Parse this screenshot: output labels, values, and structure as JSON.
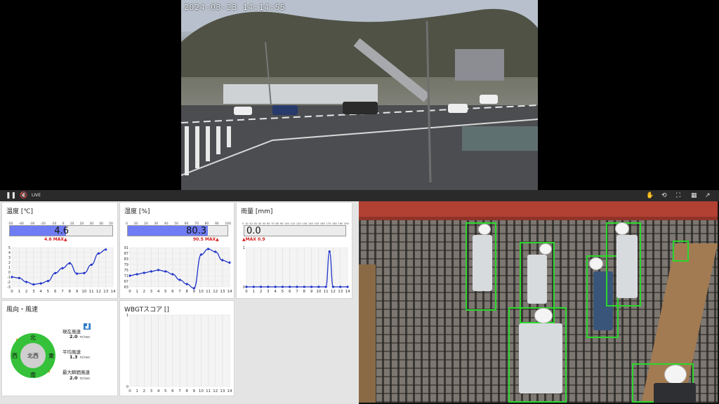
{
  "video": {
    "timestamp": "2024-03-23 14:14:55",
    "controls": {
      "pause_icon": "pause-icon",
      "mute_icon": "mute-icon",
      "live_label": "LIVE",
      "hand_icon": "hand-icon",
      "rotate_icon": "rotate-icon",
      "fullscreen_icon": "fullscreen-icon",
      "grid_icon": "grid-icon",
      "popout_icon": "external-link-icon"
    }
  },
  "dashboard": {
    "temperature": {
      "title": "温度 [℃]",
      "scale": [
        "-50",
        "-40",
        "-30",
        "-20",
        "-10",
        "0",
        "10",
        "20",
        "30",
        "40",
        "50"
      ],
      "value": "4.6",
      "fill_fraction": 0.546,
      "max_text": "4.6 MAX▲",
      "fill_color": "#6f7cf4"
    },
    "humidity": {
      "title": "湿度 [%]",
      "scale": [
        "0",
        "10",
        "20",
        "30",
        "40",
        "50",
        "60",
        "70",
        "80",
        "90",
        "100"
      ],
      "value": "80.3",
      "fill_fraction": 0.803,
      "max_text": "90.5 MAX▲",
      "fill_color": "#6f7cf4"
    },
    "rain": {
      "title": "雨量 [mm]",
      "scale": [
        "0",
        "10",
        "20",
        "30",
        "40",
        "50",
        "60",
        "70",
        "80",
        "90",
        "100",
        "110",
        "120",
        "130",
        "140",
        "150",
        "160",
        "170",
        "180",
        "190",
        "200"
      ],
      "value": "0.0",
      "fill_fraction": 0,
      "max_text": "▲MAX 0.9"
    },
    "wind": {
      "title": "風向・風速",
      "current_label": "現在風速",
      "current_value": "2.0",
      "avg_label": "平均風速",
      "avg_value": "1.3",
      "max_label": "最大瞬間風速",
      "max_value": "2.0",
      "unit": "m/sec",
      "compass": {
        "n": "北",
        "s": "南",
        "e": "東",
        "w": "西",
        "center": "北西"
      },
      "info_icon": "chart-icon"
    },
    "wbgt": {
      "title": "WBGTスコア []"
    }
  },
  "chart_data": [
    {
      "type": "line",
      "name": "temperature",
      "x": [
        0,
        1,
        2,
        3,
        4,
        5,
        6,
        7,
        8,
        9,
        10,
        11,
        12,
        13,
        14
      ],
      "values": [
        -1,
        -1.2,
        -2,
        -2.5,
        -2.3,
        -1.8,
        -0.2,
        0.8,
        1.8,
        -0.3,
        -0.2,
        1.5,
        3.8,
        4.6,
        null
      ],
      "xlim": [
        0,
        14
      ],
      "ylim": [
        -3,
        5
      ],
      "yticks": [
        "-3",
        "-2",
        "-1",
        "0",
        "1",
        "2",
        "3",
        "4",
        "5"
      ],
      "xticks": [
        "0",
        "1",
        "2",
        "3",
        "4",
        "5",
        "6",
        "7",
        "8",
        "9",
        "10",
        "11",
        "12",
        "13",
        "14"
      ]
    },
    {
      "type": "line",
      "name": "humidity",
      "x": [
        0,
        1,
        2,
        3,
        4,
        5,
        6,
        7,
        8,
        9,
        10,
        11,
        12,
        13,
        14
      ],
      "values": [
        71,
        72,
        73,
        74,
        75,
        74,
        72,
        68,
        65,
        62,
        86,
        90,
        88,
        82,
        80.3
      ],
      "xlim": [
        0,
        14
      ],
      "ylim": [
        63,
        91
      ],
      "yticks": [
        "63",
        "67",
        "71",
        "75",
        "79",
        "83",
        "87",
        "91"
      ],
      "xticks": [
        "0",
        "1",
        "2",
        "3",
        "4",
        "5",
        "6",
        "7",
        "8",
        "9",
        "10",
        "11",
        "12",
        "13",
        "14"
      ]
    },
    {
      "type": "line",
      "name": "rain",
      "x": [
        0,
        1,
        2,
        3,
        4,
        5,
        6,
        7,
        8,
        9,
        10,
        11,
        11.5,
        12,
        13,
        14
      ],
      "values": [
        0,
        0,
        0,
        0,
        0,
        0,
        0,
        0,
        0,
        0,
        0,
        0,
        0.9,
        0,
        0,
        0
      ],
      "xlim": [
        0,
        14
      ],
      "ylim": [
        0,
        1
      ],
      "yticks": [
        "0",
        "1"
      ],
      "xticks": [
        "0",
        "1",
        "2",
        "3",
        "4",
        "5",
        "6",
        "7",
        "8",
        "9",
        "10",
        "11",
        "12",
        "13",
        "14"
      ]
    },
    {
      "type": "line",
      "name": "wbgt",
      "x": [],
      "values": [],
      "xlim": [
        0,
        14
      ],
      "ylim": [
        0,
        1
      ],
      "yticks": [
        "0",
        "1"
      ],
      "xticks": [
        "0",
        "1",
        "2",
        "3",
        "4",
        "5",
        "6",
        "7",
        "8",
        "9",
        "10",
        "11",
        "12",
        "13",
        "14"
      ]
    }
  ]
}
